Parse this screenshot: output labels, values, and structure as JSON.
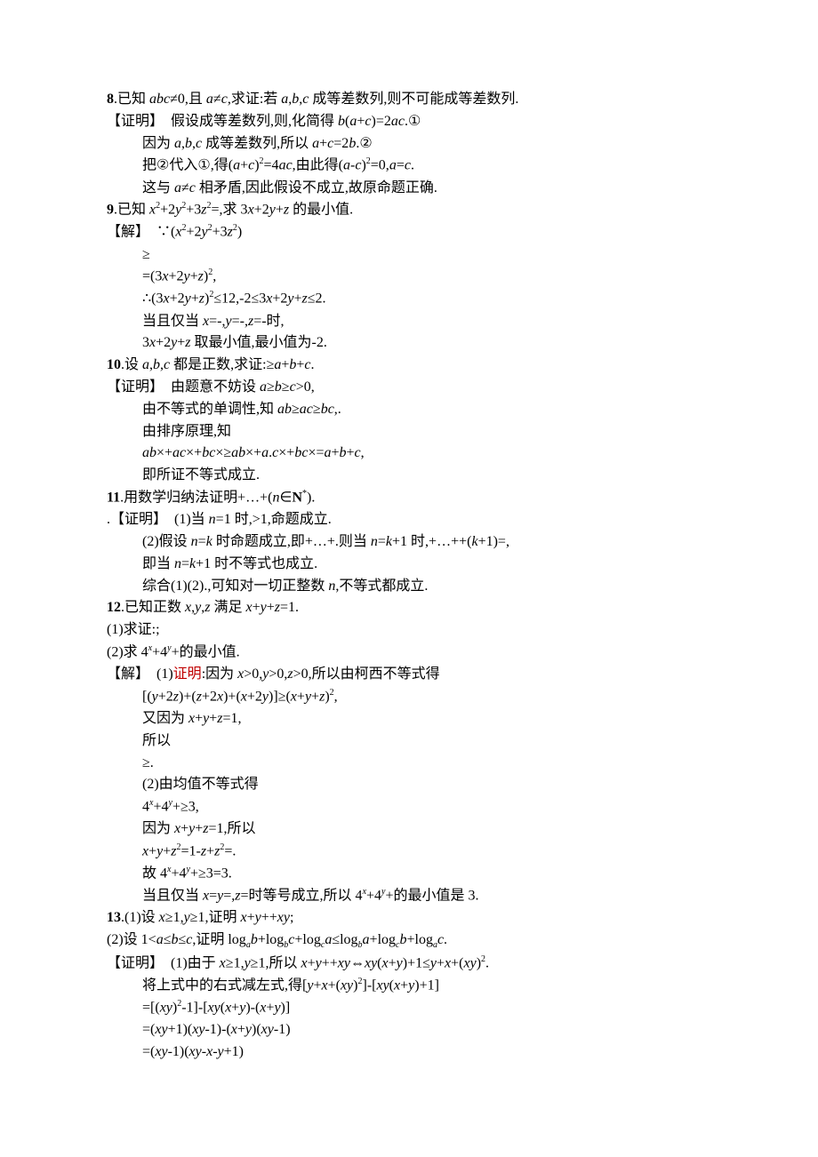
{
  "lines": [
    {
      "cls": "indent0",
      "html": "<span class='bold'>8</span>.已知 <span class='italic'>abc</span>≠0,且 <span class='italic'>a</span>≠<span class='italic'>c</span>,求证:若 <span class='italic'>a</span>,<span class='italic'>b</span>,<span class='italic'>c</span> 成等差数列,则不可能成等差数列."
    },
    {
      "cls": "indent0",
      "html": "【证明】&nbsp;&nbsp;假设成等差数列,则,化简得 <span class='italic'>b</span>(<span class='italic'>a</span>+<span class='italic'>c</span>)=2<span class='italic'>ac</span>.<span class='circ'>①</span>"
    },
    {
      "cls": "indent1",
      "html": "因为 <span class='italic'>a</span>,<span class='italic'>b</span>,<span class='italic'>c</span> 成等差数列,所以 <span class='italic'>a</span>+<span class='italic'>c</span>=2<span class='italic'>b</span>.<span class='circ'>②</span>"
    },
    {
      "cls": "indent1",
      "html": "把<span class='circ'>②</span>代入<span class='circ'>①</span>,得(<span class='italic'>a</span>+<span class='italic'>c</span>)<span class='sup-n'>2</span>=4<span class='italic'>ac</span>,由此得(<span class='italic'>a</span>-<span class='italic'>c</span>)<span class='sup-n'>2</span>=0,<span class='italic'>a</span>=<span class='italic'>c</span>."
    },
    {
      "cls": "indent1",
      "html": "这与 <span class='italic'>a</span>≠<span class='italic'>c</span> 相矛盾,因此假设不成立,故原命题正确."
    },
    {
      "cls": "indent0",
      "html": "<span class='bold'>9</span>.已知 <span class='italic'>x</span><span class='sup-n'>2</span>+2<span class='italic'>y</span><span class='sup-n'>2</span>+3<span class='italic'>z</span><span class='sup-n'>2</span>=,求 3<span class='italic'>x</span>+2<span class='italic'>y</span>+<span class='italic'>z</span> 的最小值."
    },
    {
      "cls": "indent0",
      "html": "【解】&nbsp;&nbsp;∵(<span class='italic'>x</span><span class='sup-n'>2</span>+2<span class='italic'>y</span><span class='sup-n'>2</span>+3<span class='italic'>z</span><span class='sup-n'>2</span>)"
    },
    {
      "cls": "indent1",
      "html": "≥"
    },
    {
      "cls": "indent1",
      "html": "=(3<span class='italic'>x</span>+2<span class='italic'>y</span>+<span class='italic'>z</span>)<span class='sup-n'>2</span>,"
    },
    {
      "cls": "indent1",
      "html": "∴(3<span class='italic'>x</span>+2<span class='italic'>y</span>+<span class='italic'>z</span>)<span class='sup-n'>2</span>≤12,-2≤3<span class='italic'>x</span>+2<span class='italic'>y</span>+<span class='italic'>z</span>≤2."
    },
    {
      "cls": "indent1",
      "html": "当且仅当 <span class='italic'>x</span>=-,<span class='italic'>y</span>=-,<span class='italic'>z</span>=-时,"
    },
    {
      "cls": "indent1",
      "html": "3<span class='italic'>x</span>+2<span class='italic'>y</span>+<span class='italic'>z</span> 取最小值,最小值为-2."
    },
    {
      "cls": "indent0",
      "html": "<span class='bold'>10</span>.设 <span class='italic'>a</span>,<span class='italic'>b</span>,<span class='italic'>c</span> 都是正数,求证:≥<span class='italic'>a</span>+<span class='italic'>b</span>+<span class='italic'>c</span>."
    },
    {
      "cls": "indent0",
      "html": "【证明】&nbsp;&nbsp;由题意不妨设 <span class='italic'>a</span>≥<span class='italic'>b</span>≥<span class='italic'>c</span>&gt;0,"
    },
    {
      "cls": "indent1",
      "html": "由不等式的单调性,知 <span class='italic'>ab</span>≥<span class='italic'>ac</span>≥<span class='italic'>bc</span>,."
    },
    {
      "cls": "indent1",
      "html": "由排序原理,知"
    },
    {
      "cls": "indent1",
      "html": "<span class='italic'>ab</span>×+<span class='italic'>ac</span>×+<span class='italic'>bc</span>×≥<span class='italic'>ab</span>×+<span class='italic'>a</span>.<span class='italic'>c</span>×+<span class='italic'>bc</span>×=<span class='italic'>a</span>+<span class='italic'>b</span>+<span class='italic'>c</span>,"
    },
    {
      "cls": "indent1",
      "html": "即所证不等式成立."
    },
    {
      "cls": "indent0",
      "html": "<span class='bold'>11</span>.用数学归纳法证明+…+(<span class='italic'>n</span>∈<span class='bold'>N</span><span class='sup-n'>*</span>)."
    },
    {
      "cls": "indent0",
      "html": ".【证明】&nbsp;&nbsp;(1)当 <span class='italic'>n</span>=1 时,&gt;1,命题成立."
    },
    {
      "cls": "indent1",
      "html": "(2)假设 <span class='italic'>n</span>=<span class='italic'>k</span> 时命题成立,即+…+.则当 <span class='italic'>n</span>=<span class='italic'>k</span>+1 时,+…++(<span class='italic'>k</span>+1)=,"
    },
    {
      "cls": "indent1",
      "html": "即当 <span class='italic'>n</span>=<span class='italic'>k</span>+1 时不等式也成立."
    },
    {
      "cls": "indent1",
      "html": "综合(1)(2).,可知对一切正整数 <span class='italic'>n</span>,不等式都成立."
    },
    {
      "cls": "indent0",
      "html": "<span class='bold'>12</span>.已知正数 <span class='italic'>x</span>,<span class='italic'>y</span>,<span class='italic'>z</span> 满足 <span class='italic'>x</span>+<span class='italic'>y</span>+<span class='italic'>z</span>=1."
    },
    {
      "cls": "indent0",
      "html": "(1)求证:;"
    },
    {
      "cls": "indent0",
      "html": "(2)求 4<span class='sup'>x</span>+4<span class='sup'>y</span>+的最小值."
    },
    {
      "cls": "indent0",
      "html": "【解】&nbsp;&nbsp;(1)<span class='red'>证明</span>:因为 <span class='italic'>x</span>&gt;0,<span class='italic'>y</span>&gt;0,<span class='italic'>z</span>&gt;0,所以由柯西不等式得"
    },
    {
      "cls": "indent1",
      "html": "[(<span class='italic'>y</span>+2<span class='italic'>z</span>)+(<span class='italic'>z</span>+2<span class='italic'>x</span>)+(<span class='italic'>x</span>+2<span class='italic'>y</span>)]≥(<span class='italic'>x</span>+<span class='italic'>y</span>+<span class='italic'>z</span>)<span class='sup-n'>2</span>,"
    },
    {
      "cls": "indent1",
      "html": "又因为 <span class='italic'>x</span>+<span class='italic'>y</span>+<span class='italic'>z</span>=1,"
    },
    {
      "cls": "indent1",
      "html": "所以"
    },
    {
      "cls": "indent1",
      "html": "≥."
    },
    {
      "cls": "indent1",
      "html": "(2)由均值不等式得"
    },
    {
      "cls": "indent1",
      "html": "4<span class='sup'>x</span>+4<span class='sup'>y</span>+≥3,"
    },
    {
      "cls": "indent1",
      "html": "因为 <span class='italic'>x</span>+<span class='italic'>y</span>+<span class='italic'>z</span>=1,所以"
    },
    {
      "cls": "indent1",
      "html": "<span class='italic'>x</span>+<span class='italic'>y</span>+<span class='italic'>z</span><span class='sup-n'>2</span>=1-<span class='italic'>z</span>+<span class='italic'>z</span><span class='sup-n'>2</span>=."
    },
    {
      "cls": "indent1",
      "html": "故 4<span class='sup'>x</span>+4<span class='sup'>y</span>+≥3=3."
    },
    {
      "cls": "indent1",
      "html": "当且仅当 <span class='italic'>x</span>=<span class='italic'>y</span>=,<span class='italic'>z</span>=时等号成立,所以 4<span class='sup'>x</span>+4<span class='sup'>y</span>+的最小值是 3."
    },
    {
      "cls": "indent0",
      "html": "<span class='bold'>13</span>.(1)设 <span class='italic'>x</span>≥1,<span class='italic'>y</span>≥1,证明 <span class='italic'>x</span>+<span class='italic'>y</span>++<span class='italic'>xy</span>;"
    },
    {
      "cls": "indent0",
      "html": "(2)设 1&lt;<span class='italic'>a</span>≤<span class='italic'>b</span>≤<span class='italic'>c</span>,证明 log<span class='sub'>a</span><span class='italic'>b</span>+log<span class='sub'>b</span><span class='italic'>c</span>+log<span class='sub'>c</span><span class='italic'>a</span>≤log<span class='sub'>b</span><span class='italic'>a</span>+log<span class='sub'>c</span><span class='italic'>b</span>+log<span class='sub'>a</span><span class='italic'>c</span>."
    },
    {
      "cls": "indent0",
      "html": "【证明】&nbsp;&nbsp;(1)由于 <span class='italic'>x</span>≥1,<span class='italic'>y</span>≥1,所以 <span class='italic'>x</span>+<span class='italic'>y</span>++<span class='italic'>xy</span>⇔<span class='italic'>xy</span>(<span class='italic'>x</span>+<span class='italic'>y</span>)+1≤<span class='italic'>y</span>+<span class='italic'>x</span>+(<span class='italic'>xy</span>)<span class='sup-n'>2</span>."
    },
    {
      "cls": "indent1",
      "html": "将上式中的右式减左式,得[<span class='italic'>y</span>+<span class='italic'>x</span>+(<span class='italic'>xy</span>)<span class='sup-n'>2</span>]-[<span class='italic'>xy</span>(<span class='italic'>x</span>+<span class='italic'>y</span>)+1]"
    },
    {
      "cls": "indent1",
      "html": "=[(<span class='italic'>xy</span>)<span class='sup-n'>2</span>-1]-[<span class='italic'>xy</span>(<span class='italic'>x</span>+<span class='italic'>y</span>)-(<span class='italic'>x</span>+<span class='italic'>y</span>)]"
    },
    {
      "cls": "indent1",
      "html": "=(<span class='italic'>xy</span>+1)(<span class='italic'>xy</span>-1)-(<span class='italic'>x</span>+<span class='italic'>y</span>)(<span class='italic'>xy</span>-1)"
    },
    {
      "cls": "indent1",
      "html": "=(<span class='italic'>xy</span>-1)(<span class='italic'>xy</span>-<span class='italic'>x</span>-<span class='italic'>y</span>+1)"
    }
  ]
}
